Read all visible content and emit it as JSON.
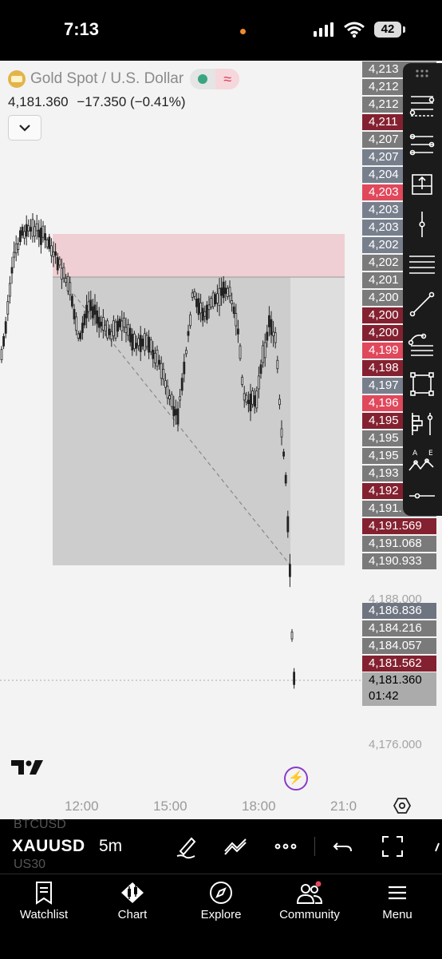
{
  "status_bar": {
    "time": "7:13",
    "battery": "42"
  },
  "header": {
    "symbol_name": "Gold Spot / U.S. Dollar",
    "last_price": "4,181.360",
    "change": "−17.350",
    "change_pct": "(−0.41%)",
    "wave_glyph": "≈"
  },
  "price_labels": [
    {
      "text": "4,213",
      "style": "gray"
    },
    {
      "text": "4,212",
      "style": "gray"
    },
    {
      "text": "4,212",
      "style": "gray"
    },
    {
      "text": "4,211",
      "style": "red"
    },
    {
      "text": "4,207",
      "style": "gray"
    },
    {
      "text": "4,207",
      "style": "slate"
    },
    {
      "text": "4,204",
      "style": "slate"
    },
    {
      "text": "4,203",
      "style": "bright"
    },
    {
      "text": "4,203",
      "style": "slate"
    },
    {
      "text": "4,203",
      "style": "slate"
    },
    {
      "text": "4,202",
      "style": "slate"
    },
    {
      "text": "4,202",
      "style": "gray"
    },
    {
      "text": "4,201",
      "style": "gray"
    },
    {
      "text": "4,200",
      "style": "gray"
    },
    {
      "text": "4,200",
      "style": "red"
    },
    {
      "text": "4,200",
      "style": "red"
    },
    {
      "text": "4,199",
      "style": "bright"
    },
    {
      "text": "4,198",
      "style": "red"
    },
    {
      "text": "4,197",
      "style": "slate"
    },
    {
      "text": "4,196",
      "style": "bright"
    },
    {
      "text": "4,195",
      "style": "red"
    },
    {
      "text": "4,195",
      "style": "gray"
    },
    {
      "text": "4,195",
      "style": "gray"
    },
    {
      "text": "4,193",
      "style": "gray"
    },
    {
      "text": "4,192",
      "style": "red"
    },
    {
      "text": "4,191.",
      "style": "gray"
    },
    {
      "text": "4,191.569",
      "style": "red"
    },
    {
      "text": "4,191.068",
      "style": "gray"
    },
    {
      "text": "4,190.933",
      "style": "gray"
    },
    {
      "text": "4,186.836",
      "style": "blue"
    },
    {
      "text": "4,184.216",
      "style": "gray"
    },
    {
      "text": "4,184.057",
      "style": "gray"
    },
    {
      "text": "4,181.562",
      "style": "red"
    }
  ],
  "current_price": {
    "price": "4,181.360",
    "countdown": "01:42"
  },
  "axis_ticks": [
    "4,188.000",
    "4,176.000"
  ],
  "time_axis": [
    "12:00",
    "15:00",
    "18:00",
    "21:0"
  ],
  "toolbar": {
    "symbol_ghost_top": "BTCUSD",
    "symbol": "XAUUSD",
    "symbol_ghost_bottom": "US30",
    "interval": "5m"
  },
  "tabs": [
    {
      "label": "Watchlist"
    },
    {
      "label": "Chart"
    },
    {
      "label": "Explore"
    },
    {
      "label": "Community"
    },
    {
      "label": "Menu"
    }
  ],
  "colors": {
    "zone_red": "#efcfd3",
    "zone_gray": "#cdcdcd",
    "accent_purple": "#8a3bc9",
    "axis_red": "#842130",
    "axis_bright_red": "#e0485c"
  },
  "drawing_tools": [
    "fib-retracement-icon",
    "fib-channel-icon",
    "long-position-icon",
    "vertical-line-icon",
    "parallel-channel-icon",
    "trend-line-icon",
    "pitchfork-icon",
    "rectangle-icon",
    "volume-profile-icon",
    "elliott-wave-icon",
    "horizontal-ray-icon"
  ]
}
